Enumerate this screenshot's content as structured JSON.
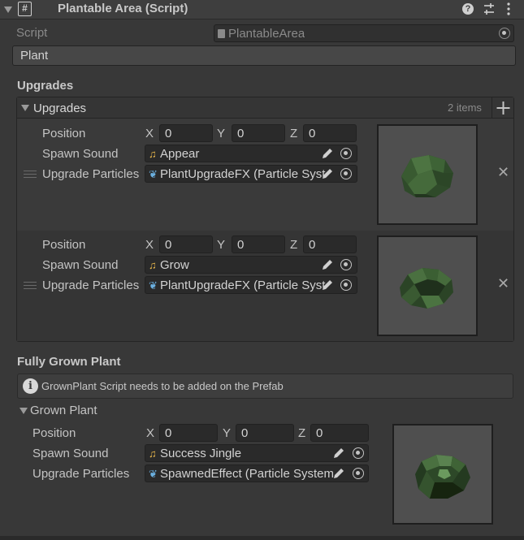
{
  "header": {
    "title": "Plantable Area (Script)",
    "help_icon": "question-icon",
    "settings_icon": "sliders-icon",
    "menu_icon": "kebab-icon"
  },
  "script_row": {
    "label": "Script",
    "value": "PlantableArea"
  },
  "plant_button": {
    "label": "Plant"
  },
  "upgrades_section": {
    "header": "Upgrades",
    "list_label": "Upgrades",
    "count": "2 items",
    "items": [
      {
        "position_label": "Position",
        "x_label": "X",
        "x": "0",
        "y_label": "Y",
        "y": "0",
        "z_label": "Z",
        "z": "0",
        "spawn_sound_label": "Spawn Sound",
        "spawn_sound": "Appear",
        "particles_label": "Upgrade Particles",
        "particles": "PlantUpgradeFX (Particle Syst"
      },
      {
        "position_label": "Position",
        "x_label": "X",
        "x": "0",
        "y_label": "Y",
        "y": "0",
        "z_label": "Z",
        "z": "0",
        "spawn_sound_label": "Spawn Sound",
        "spawn_sound": "Grow",
        "particles_label": "Upgrade Particles",
        "particles": "PlantUpgradeFX (Particle Syst"
      }
    ]
  },
  "fully_grown": {
    "header": "Fully Grown Plant",
    "info": "GrownPlant Script needs to be added on the Prefab",
    "foldout": "Grown Plant",
    "position_label": "Position",
    "x_label": "X",
    "x": "0",
    "y_label": "Y",
    "y": "0",
    "z_label": "Z",
    "z": "0",
    "spawn_sound_label": "Spawn Sound",
    "spawn_sound": "Success Jingle",
    "particles_label": "Upgrade Particles",
    "particles": "SpawnedEffect (Particle System"
  },
  "colors": {
    "background": "#383838",
    "field": "#2a2a2a",
    "header": "#3e3e3e",
    "plant_green": "#3f5e36"
  }
}
